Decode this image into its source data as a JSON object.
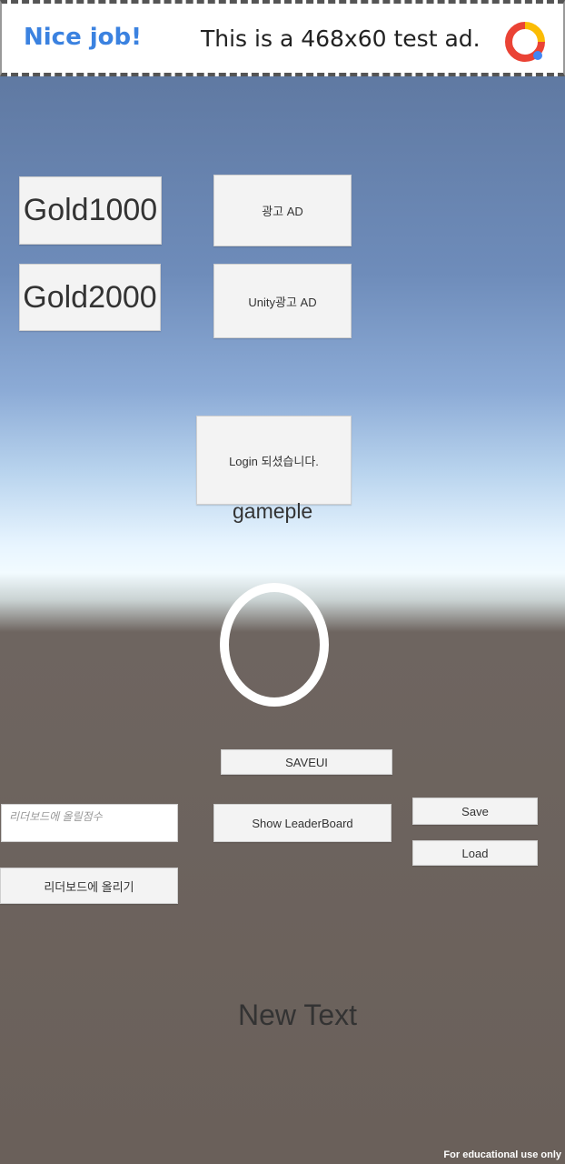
{
  "ad_banner": {
    "title": "Nice job!",
    "text": "This is a 468x60 test ad.",
    "logo_icon": "google-ads-icon"
  },
  "buttons": {
    "gold1000": "Gold1000",
    "gold2000": "Gold2000",
    "ad": "광고 AD",
    "unity_ad": "Unity광고 AD",
    "login": "Login 되셨습니다.",
    "saveui": "SAVEUI",
    "show_leaderboard": "Show LeaderBoard",
    "save": "Save",
    "load": "Load",
    "upload_leaderboard": "리더보드에 올리기"
  },
  "labels": {
    "gameple": "gameple",
    "new_text": "New Text",
    "footer": "For educational use only"
  },
  "inputs": {
    "score_placeholder": "리더보드에 올릴점수",
    "score_value": ""
  }
}
